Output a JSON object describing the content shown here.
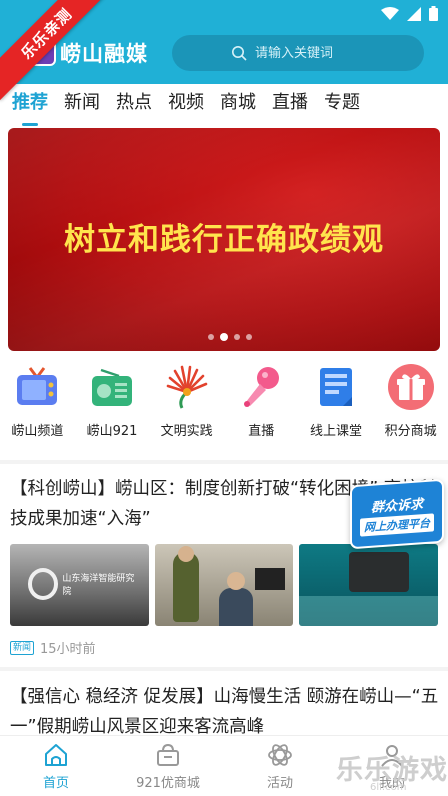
{
  "header": {
    "app_title": "崂山融媒",
    "search_placeholder": "请输入关键词",
    "ribbon_label": "乐乐亲测",
    "colors": {
      "header_bg": "#20b0d6",
      "accent": "#1ea3d3",
      "ribbon": "#e52525"
    }
  },
  "tabs": [
    {
      "label": "推荐",
      "active": true
    },
    {
      "label": "新闻",
      "active": false
    },
    {
      "label": "热点",
      "active": false
    },
    {
      "label": "视频",
      "active": false
    },
    {
      "label": "商城",
      "active": false
    },
    {
      "label": "直播",
      "active": false
    },
    {
      "label": "专题",
      "active": false
    }
  ],
  "banner": {
    "headline": "树立和践行正确政绩观",
    "slide_count": 4,
    "active_slide": 2
  },
  "shortcuts": [
    {
      "label": "崂山频道",
      "icon": "tv-icon"
    },
    {
      "label": "崂山921",
      "icon": "radio-icon"
    },
    {
      "label": "文明实践",
      "icon": "civilization-emblem-icon"
    },
    {
      "label": "直播",
      "icon": "microphone-icon"
    },
    {
      "label": "线上课堂",
      "icon": "document-icon"
    },
    {
      "label": "积分商城",
      "icon": "gift-icon"
    }
  ],
  "articles": [
    {
      "title": "【科创崂山】崂山区：制度创新打破“转化困境” 高校科技成果加速“入海”",
      "tag": "新闻",
      "time": "15小时前",
      "thumb1_sign": "山东海洋智能研究院"
    },
    {
      "title": "【强信心 稳经济 促发展】山海慢生活 颐游在崂山—“五一”假期崂山风景区迎来客流高峰"
    }
  ],
  "float_badge": {
    "line1": "群众诉求",
    "line2": "网上办理平台"
  },
  "bottom_nav": [
    {
      "label": "首页",
      "icon": "home-icon",
      "active": true
    },
    {
      "label": "921优商城",
      "icon": "shop-icon",
      "active": false
    },
    {
      "label": "活动",
      "icon": "activity-icon",
      "active": false
    },
    {
      "label": "我的",
      "icon": "user-icon",
      "active": false
    }
  ],
  "watermark": {
    "text": "乐乐游戏",
    "sub": "6ll.com"
  }
}
